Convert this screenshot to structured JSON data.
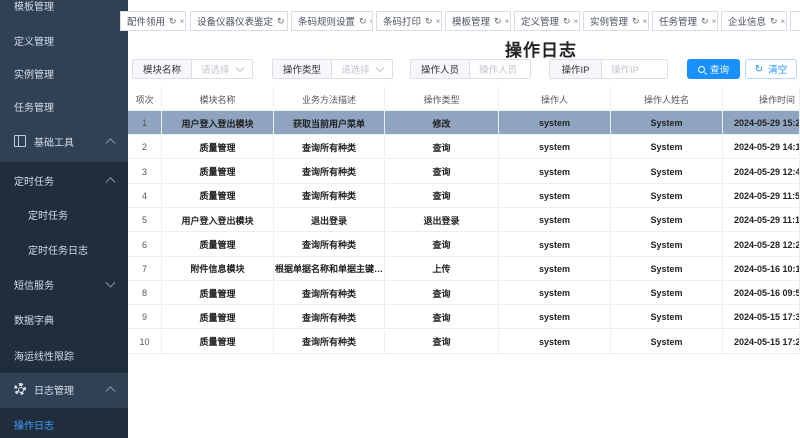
{
  "sidebar": {
    "items": [
      {
        "label": "模板管理"
      },
      {
        "label": "定义管理"
      },
      {
        "label": "实例管理"
      },
      {
        "label": "任务管理"
      },
      {
        "label": "基础工具",
        "icon": "tools-icon"
      },
      {
        "label": "定时任务"
      },
      {
        "label": "定时任务"
      },
      {
        "label": "定时任务日志"
      },
      {
        "label": "短信服务"
      },
      {
        "label": "数据字典"
      },
      {
        "label": "海运线性限踪"
      },
      {
        "label": "日志管理",
        "icon": "gear-icon"
      },
      {
        "label": "操作日志"
      }
    ]
  },
  "tags": [
    {
      "label": "配件领用"
    },
    {
      "label": "设备仪器仪表鉴定"
    },
    {
      "label": "条码规则设置"
    },
    {
      "label": "条码打印"
    },
    {
      "label": "模板管理"
    },
    {
      "label": "定义管理"
    },
    {
      "label": "实例管理"
    },
    {
      "label": "任务管理"
    },
    {
      "label": "企业信息"
    }
  ],
  "tag_close": "×",
  "tag_refresh": "↻",
  "page_title": "操作日志",
  "filters": {
    "module": {
      "label": "模块名称",
      "placeholder": "请选择"
    },
    "op_type": {
      "label": "操作类型",
      "placeholder": "请选择"
    },
    "operator": {
      "label": "操作人员",
      "placeholder": "操作人员"
    },
    "ip": {
      "label": "操作IP",
      "placeholder": "操作IP"
    }
  },
  "buttons": {
    "query": "查询",
    "reset": "清空"
  },
  "table": {
    "headers": [
      "项次",
      "模块名称",
      "业务方法描述",
      "操作类型",
      "操作人",
      "操作人姓名",
      "操作时间"
    ],
    "rows": [
      [
        "1",
        "用户登入登出模块",
        "获取当前用户菜单",
        "修改",
        "system",
        "System",
        "2024-05-29 15:2"
      ],
      [
        "2",
        "质量管理",
        "查询所有种类",
        "查询",
        "system",
        "System",
        "2024-05-29 14:1"
      ],
      [
        "3",
        "质量管理",
        "查询所有种类",
        "查询",
        "system",
        "System",
        "2024-05-29 12:4"
      ],
      [
        "4",
        "质量管理",
        "查询所有种类",
        "查询",
        "system",
        "System",
        "2024-05-29 11:5"
      ],
      [
        "5",
        "用户登入登出模块",
        "退出登录",
        "退出登录",
        "system",
        "System",
        "2024-05-29 11:1"
      ],
      [
        "6",
        "质量管理",
        "查询所有种类",
        "查询",
        "system",
        "System",
        "2024-05-28 12:2"
      ],
      [
        "7",
        "附件信息模块",
        "根据单据名称和单据主键…",
        "上传",
        "system",
        "System",
        "2024-05-16 10:1"
      ],
      [
        "8",
        "质量管理",
        "查询所有种类",
        "查询",
        "system",
        "System",
        "2024-05-16 09:5"
      ],
      [
        "9",
        "质量管理",
        "查询所有种类",
        "查询",
        "system",
        "System",
        "2024-05-15 17:3"
      ],
      [
        "10",
        "质量管理",
        "查询所有种类",
        "查询",
        "system",
        "System",
        "2024-05-15 17:2"
      ]
    ],
    "selected_row": 0
  },
  "colors": {
    "sidebar_bg": "#304156",
    "submenu_bg": "#1f2d3d",
    "active": "#409eff",
    "primary": "#1890ff",
    "selected_row": "#8fa4bf"
  }
}
